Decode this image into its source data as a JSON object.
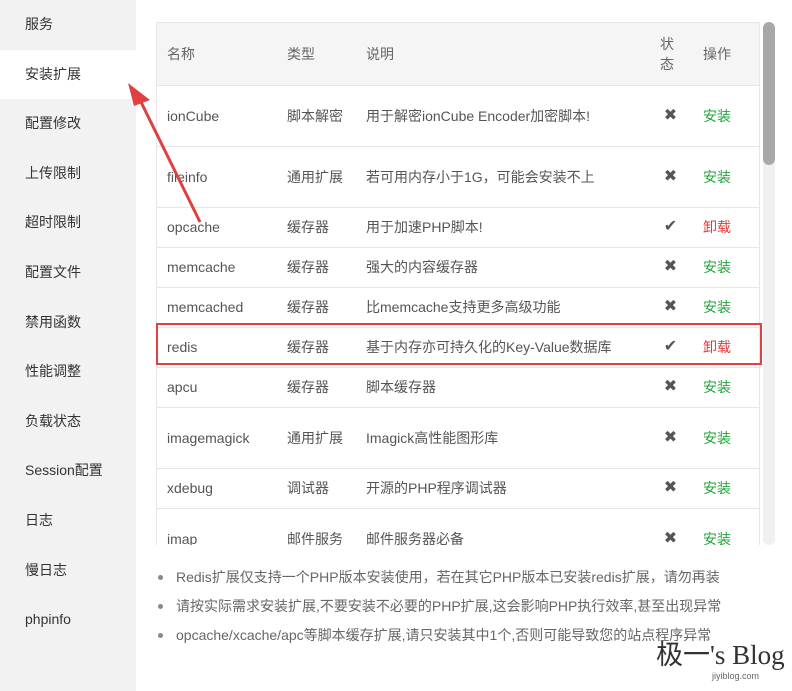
{
  "sidebar": {
    "items": [
      {
        "label": "服务"
      },
      {
        "label": "安装扩展",
        "active": true
      },
      {
        "label": "配置修改"
      },
      {
        "label": "上传限制"
      },
      {
        "label": "超时限制"
      },
      {
        "label": "配置文件"
      },
      {
        "label": "禁用函数"
      },
      {
        "label": "性能调整"
      },
      {
        "label": "负载状态"
      },
      {
        "label": "Session配置"
      },
      {
        "label": "日志"
      },
      {
        "label": "慢日志"
      },
      {
        "label": "phpinfo"
      }
    ]
  },
  "table": {
    "headers": [
      "名称",
      "类型",
      "说明",
      "状态",
      "操作"
    ],
    "rows": [
      {
        "name": "ionCube",
        "type": "脚本解密",
        "desc": "用于解密ionCube Encoder加密脚本!",
        "status": "not-installed",
        "status_icon": "✖",
        "action": "安装"
      },
      {
        "name": "fileinfo",
        "type": "通用扩展",
        "desc": "若可用内存小于1G，可能会安装不上",
        "status": "not-installed",
        "status_icon": "✖",
        "action": "安装"
      },
      {
        "name": "opcache",
        "type": "缓存器",
        "desc": "用于加速PHP脚本!",
        "status": "installed",
        "status_icon": "✔",
        "action": "卸载"
      },
      {
        "name": "memcache",
        "type": "缓存器",
        "desc": "强大的内容缓存器",
        "status": "not-installed",
        "status_icon": "✖",
        "action": "安装"
      },
      {
        "name": "memcached",
        "type": "缓存器",
        "desc": "比memcache支持更多高级功能",
        "status": "not-installed",
        "status_icon": "✖",
        "action": "安装"
      },
      {
        "name": "redis",
        "type": "缓存器",
        "desc": "基于内存亦可持久化的Key-Value数据库",
        "status": "installed",
        "status_icon": "✔",
        "action": "卸载",
        "highlighted": true
      },
      {
        "name": "apcu",
        "type": "缓存器",
        "desc": "脚本缓存器",
        "status": "not-installed",
        "status_icon": "✖",
        "action": "安装"
      },
      {
        "name": "imagemagick",
        "type": "通用扩展",
        "desc": "Imagick高性能图形库",
        "status": "not-installed",
        "status_icon": "✖",
        "action": "安装"
      },
      {
        "name": "xdebug",
        "type": "调试器",
        "desc": "开源的PHP程序调试器",
        "status": "not-installed",
        "status_icon": "✖",
        "action": "安装"
      },
      {
        "name": "imap",
        "type": "邮件服务",
        "desc": "邮件服务器必备",
        "status": "not-installed",
        "status_icon": "✖",
        "action": "安装"
      }
    ]
  },
  "notes": [
    "Redis扩展仅支持一个PHP版本安装使用，若在其它PHP版本已安装redis扩展，请勿再装",
    "请按实际需求安装扩展,不要安装不必要的PHP扩展,这会影响PHP执行效率,甚至出现异常",
    "opcache/xcache/apc等脚本缓存扩展,请只安装其中1个,否则可能导致您的站点程序异常"
  ],
  "watermark": {
    "title": "极一's Blog",
    "url": "jiyiblog.com"
  },
  "colors": {
    "install": "#20a53a",
    "uninstall": "#e23d3d",
    "highlight": "#e04040"
  }
}
